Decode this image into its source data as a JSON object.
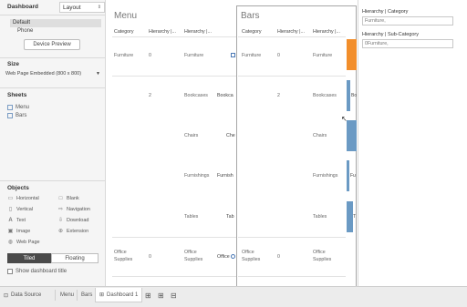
{
  "left_panel": {
    "tab_dashboard": "Dashboard",
    "tab_layout": "Layout",
    "devices": [
      "Default",
      "Phone"
    ],
    "device_preview_label": "Device Preview",
    "size_title": "Size",
    "size_value": "Web Page Embedded (800 x 800)",
    "sheets_title": "Sheets",
    "sheets": [
      "Menu",
      "Bars"
    ],
    "objects_title": "Objects",
    "objects": [
      "Horizontal",
      "Blank",
      "Vertical",
      "Navigation",
      "Text",
      "Download",
      "Image",
      "Extension",
      "Web Page"
    ],
    "tiled_label": "Tiled",
    "floating_label": "Floating",
    "show_title_label": "Show dashboard title"
  },
  "menu_sheet": {
    "title": "Menu",
    "headers": [
      "Category",
      "Hierarchy |...",
      "Hierarchy |..."
    ],
    "rows": [
      {
        "category": "Furniture",
        "value": "0",
        "sub": "Furniture"
      },
      {
        "category": "",
        "value": "2",
        "sub": "Bookcases"
      },
      {
        "category": "",
        "value": "",
        "sub": "Chairs"
      },
      {
        "category": "",
        "value": "",
        "sub": "Furnishings"
      },
      {
        "category": "",
        "value": "",
        "sub": "Tables"
      },
      {
        "category": "Office Supplies",
        "value": "0",
        "sub": "Office Supplies"
      }
    ],
    "truncated": [
      "",
      "Bookca",
      "Che",
      "Furnish",
      "Tab",
      "Office"
    ]
  },
  "bars_sheet": {
    "title": "Bars",
    "headers": [
      "Category",
      "Hierarchy |...",
      "Hierarchy |..."
    ],
    "rows": [
      {
        "category": "Furniture",
        "value": "0",
        "sub": "Furniture",
        "bar_label": "",
        "fill": 1.0,
        "color": "#f28e2b"
      },
      {
        "category": "",
        "value": "2",
        "sub": "Bookcases",
        "bar_label": "Bo",
        "fill": 0.35,
        "color": "#6b9ac4"
      },
      {
        "category": "",
        "value": "",
        "sub": "Chairs",
        "bar_label": "",
        "fill": 1.0,
        "color": "#6b9ac4"
      },
      {
        "category": "",
        "value": "",
        "sub": "Furnishings",
        "bar_label": "Fu",
        "fill": 0.3,
        "color": "#6b9ac4"
      },
      {
        "category": "",
        "value": "",
        "sub": "Tables",
        "bar_label": "T",
        "fill": 0.65,
        "color": "#6b9ac4"
      },
      {
        "category": "Office Supplies",
        "value": "0",
        "sub": "Office Supplies",
        "bar_label": "",
        "fill": 0,
        "color": "#6b9ac4"
      }
    ]
  },
  "right_panel": {
    "filter1_title": "Hierarchy | Category",
    "filter1_value": "Furniture,",
    "filter2_title": "Hierarchy | Sub-Category",
    "filter2_value": "0Furniture,"
  },
  "bottom_bar": {
    "data_source": "Data Source",
    "tabs": [
      "Menu",
      "Bars",
      "Dashboard 1"
    ]
  }
}
